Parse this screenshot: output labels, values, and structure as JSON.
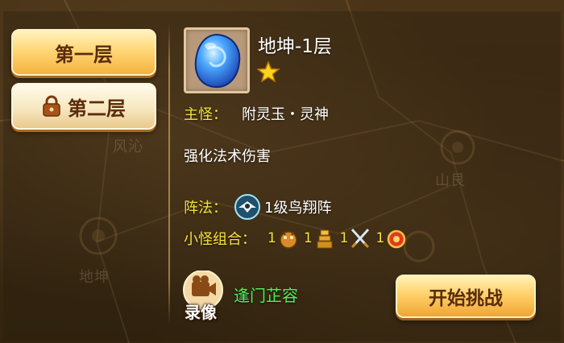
{
  "floors": [
    {
      "label": "第一层",
      "state": "selected"
    },
    {
      "label": "第二层",
      "state": "locked"
    }
  ],
  "map_labels": [
    "地坤",
    "山艮",
    "风沁"
  ],
  "stage": {
    "title": "地坤-1层",
    "stars": 1,
    "boss_label": "主怪：",
    "boss_name": "附灵玉・灵神",
    "description": "强化法术伤害",
    "formation_label": "阵法：",
    "formation_name": "1级鸟翔阵",
    "minions_label": "小怪组合：",
    "minions": [
      {
        "count": "1",
        "icon": "golden-beast-icon"
      },
      {
        "count": "1",
        "icon": "golden-tower-icon"
      },
      {
        "count": "1",
        "icon": "crossed-swords-icon"
      },
      {
        "count": "1",
        "icon": "red-orb-icon"
      }
    ]
  },
  "replay": {
    "label": "录像",
    "player_name": "逢门芷容"
  },
  "actions": {
    "start_label": "开始挑战"
  },
  "colors": {
    "label_yellow": "#f5e23c",
    "player_green": "#4cf05a",
    "button_gold": "#ffd16a",
    "button_text": "#5a2c0a"
  }
}
